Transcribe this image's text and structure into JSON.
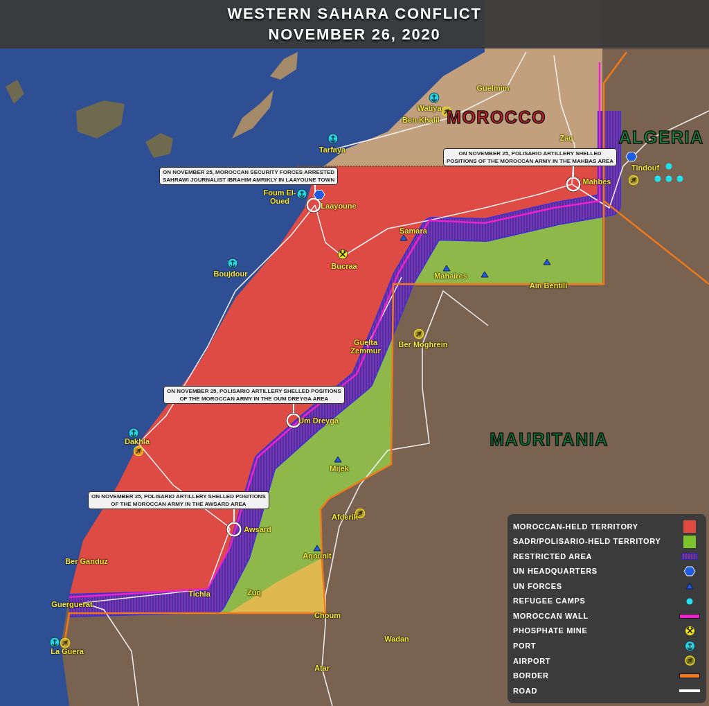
{
  "title": {
    "line_1": "WESTERN SAHARA CONFLICT",
    "line_2": "NOVEMBER 26, 2020"
  },
  "map": {
    "countries": [
      {
        "name": "MOROCCO",
        "kind": "morocco"
      },
      {
        "name": "ALGERIA",
        "kind": "algeria"
      },
      {
        "name": "MAURITANIA",
        "kind": "mauritania"
      }
    ],
    "places": [
      {
        "name": "Guelmim"
      },
      {
        "name": "Watiya",
        "markers": [
          {
            "kind": "port"
          },
          {
            "kind": "airport"
          }
        ]
      },
      {
        "name": "Ben Khalil"
      },
      {
        "name": "Tarfaya",
        "markers": [
          {
            "kind": "port"
          }
        ]
      },
      {
        "name": "Zaq"
      },
      {
        "name": "Tindouf",
        "markers": [
          {
            "kind": "un_hq"
          },
          {
            "kind": "airport"
          },
          {
            "kind": "camp"
          },
          {
            "kind": "camp"
          },
          {
            "kind": "camp"
          },
          {
            "kind": "camp"
          }
        ]
      },
      {
        "name": "Mahbes",
        "markers": [
          {
            "kind": "event"
          }
        ]
      },
      {
        "name": "Foum El-Oued",
        "markers": [
          {
            "kind": "port"
          }
        ]
      },
      {
        "name": "Laayoune",
        "markers": [
          {
            "kind": "event"
          },
          {
            "kind": "un_hq"
          }
        ]
      },
      {
        "name": "Samara",
        "markers": [
          {
            "kind": "un_forces"
          }
        ]
      },
      {
        "name": "Bucraa",
        "markers": [
          {
            "kind": "mine"
          }
        ]
      },
      {
        "name": "Boujdour",
        "markers": [
          {
            "kind": "port"
          }
        ]
      },
      {
        "name": "Mahaires",
        "markers": [
          {
            "kind": "un_forces"
          },
          {
            "kind": "un_forces"
          },
          {
            "kind": "un_forces"
          }
        ]
      },
      {
        "name": "Ain Bentili"
      },
      {
        "name": "Guelta Zemmur"
      },
      {
        "name": "Ber Moghrein",
        "markers": [
          {
            "kind": "airport"
          }
        ]
      },
      {
        "name": "Um Dreyga",
        "markers": [
          {
            "kind": "event"
          }
        ]
      },
      {
        "name": "Dakhla",
        "markers": [
          {
            "kind": "port"
          },
          {
            "kind": "airport"
          }
        ]
      },
      {
        "name": "Mijek",
        "markers": [
          {
            "kind": "un_forces"
          }
        ]
      },
      {
        "name": "Afderik",
        "markers": [
          {
            "kind": "airport"
          }
        ]
      },
      {
        "name": "Awsard",
        "markers": [
          {
            "kind": "event"
          }
        ]
      },
      {
        "name": "Aqounit",
        "markers": [
          {
            "kind": "un_forces"
          }
        ]
      },
      {
        "name": "Ber Ganduz"
      },
      {
        "name": "Tichla"
      },
      {
        "name": "Zuq"
      },
      {
        "name": "Guerguerat"
      },
      {
        "name": "Choum"
      },
      {
        "name": "La Guera",
        "markers": [
          {
            "kind": "port"
          },
          {
            "kind": "airport"
          }
        ]
      },
      {
        "name": "Wadan"
      },
      {
        "name": "Atar"
      }
    ],
    "callouts": [
      {
        "lines": [
          "ON NOVEMBER 25, MOROCCAN SECURITY FORCES ARRESTED",
          "SAHRAWI JOURNALIST IBRAHIM AMRIKLY IN LAAYOUNE TOWN"
        ]
      },
      {
        "lines": [
          "ON NOVEMBER 25, POLISARIO ARTILLERY SHELLED",
          "POSITIONS OF THE MOROCCAN ARMY IN THE MAHBAS AREA"
        ]
      },
      {
        "lines": [
          "ON NOVEMBER 25, POLISARIO ARTILLERY SHELLED POSITIONS",
          "OF THE MOROCCAN ARMY IN THE OUM DREYGA AREA"
        ]
      },
      {
        "lines": [
          "ON NOVEMBER 25, POLISARIO ARTILLERY SHELLED POSITIONS",
          "OF THE MOROCCAN ARMY IN THE AWSARD AREA"
        ]
      }
    ]
  },
  "legend": [
    {
      "label": "MOROCCAN-HELD TERRITORY",
      "kind": "moroccan_territory"
    },
    {
      "label": "SADR/POLISARIO-HELD TERRITORY",
      "kind": "polisario_territory"
    },
    {
      "label": "RESTRICTED AREA",
      "kind": "restricted"
    },
    {
      "label": "UN HEADQUARTERS",
      "kind": "un_hq"
    },
    {
      "label": "UN FORCES",
      "kind": "un_forces"
    },
    {
      "label": "REFUGEE CAMPS",
      "kind": "camp"
    },
    {
      "label": "MOROCCAN WALL",
      "kind": "wall"
    },
    {
      "label": "PHOSPHATE MINE",
      "kind": "mine"
    },
    {
      "label": "PORT",
      "kind": "port"
    },
    {
      "label": "AIRPORT",
      "kind": "airport"
    },
    {
      "label": "BORDER",
      "kind": "border"
    },
    {
      "label": "ROAD",
      "kind": "road"
    }
  ]
}
